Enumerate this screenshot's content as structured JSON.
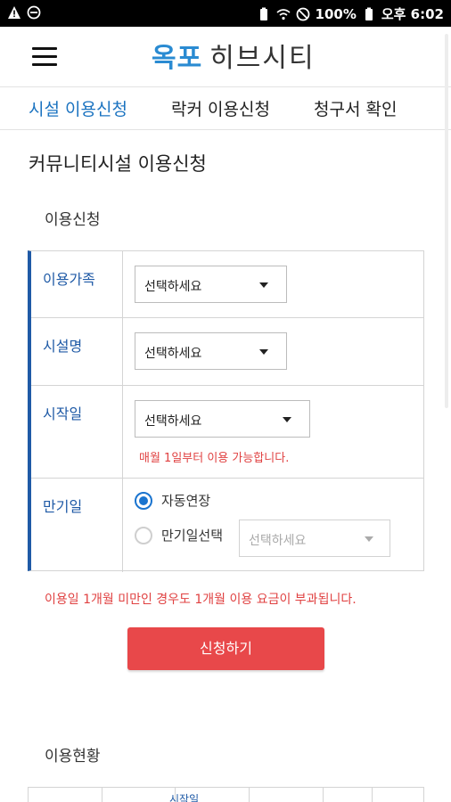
{
  "status_bar": {
    "battery": "100%",
    "time": "오후 6:02",
    "icons": [
      "warning-icon",
      "blocked-circle-icon",
      "battery-icon",
      "wifi-icon",
      "no-signal-icon"
    ]
  },
  "header": {
    "logo_part1": "옥포",
    "logo_part2": "히브시티",
    "menu_icon": "hamburger-menu-icon"
  },
  "tabs": [
    {
      "label": "시설 이용신청",
      "active": true
    },
    {
      "label": "락커 이용신청",
      "active": false
    },
    {
      "label": "청구서 확인",
      "active": false
    }
  ],
  "page_title": "커뮤니티시설 이용신청",
  "section_label": "이용신청",
  "form": {
    "family_label": "이용가족",
    "family_value": "선택하세요",
    "facility_label": "시설명",
    "facility_value": "선택하세요",
    "start_label": "시작일",
    "start_value": "선택하세요",
    "start_note": "매월 1일부터 이용 가능합니다.",
    "end_label": "만기일",
    "auto_renew_label": "자동연장",
    "end_select_label": "만기일선택",
    "end_select_value": "선택하세요"
  },
  "warning": "이용일 1개월 미만인 경우도 1개월 이용 요금이 부과됩니다.",
  "submit_label": "신청하기",
  "status_section_label": "이용현황",
  "status_table_partial_header": "시작일",
  "colors": {
    "accent_blue": "#1b73c0",
    "label_blue": "#1f5aa6",
    "warning_red": "#e04141",
    "button_red": "#e8484a"
  }
}
